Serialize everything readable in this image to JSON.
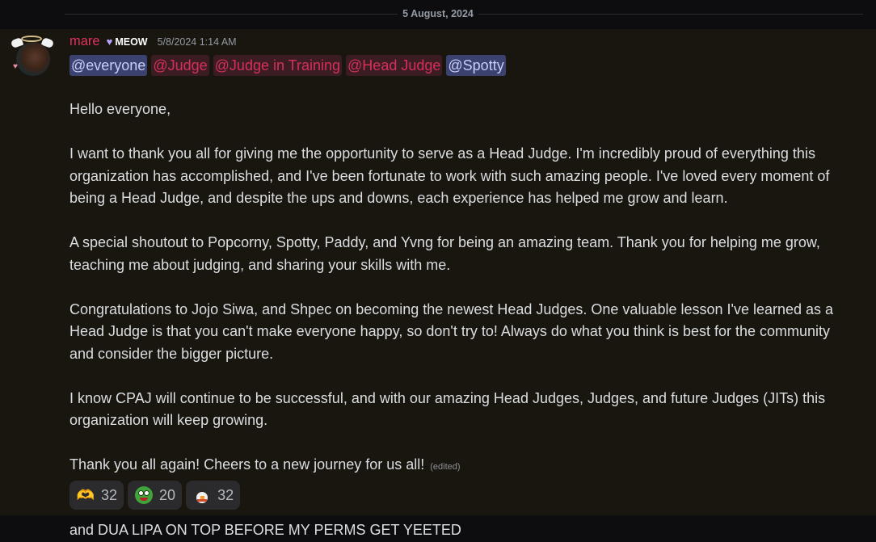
{
  "date_divider": "5 August, 2024",
  "message": {
    "author": {
      "username": "mare",
      "username_color": "#e0345e",
      "tag_icon": "heart-icon",
      "tag": "MEOW",
      "timestamp": "5/8/2024 1:14 AM"
    },
    "mentions": [
      {
        "text": "@everyone",
        "style": "blue"
      },
      {
        "text": "@Judge",
        "style": "red"
      },
      {
        "text": "@Judge in Training",
        "style": "red"
      },
      {
        "text": "@Head Judge",
        "style": "red"
      },
      {
        "text": "@Spotty",
        "style": "blue"
      }
    ],
    "paragraphs": [
      "Hello everyone,",
      "I want to thank you all for giving me the opportunity to serve as a Head Judge. I'm incredibly proud of everything this organization has accomplished, and I've been fortunate to work with such amazing people. I've loved every moment of being a Head Judge, and despite the ups and downs, each experience has helped me grow and learn.",
      "A special shoutout to Popcorny, Spotty, Paddy, and Yvng for being an amazing team. Thank you for helping me grow, teaching me about judging, and sharing your skills with me.",
      "Congratulations to Jojo Siwa, and Shpec on becoming the newest Head Judges. One valuable lesson I've learned as a Head Judge is that you can't make everyone happy, so don't try to! Always do what you think is best for the community and consider the bigger picture.",
      "I know CPAJ will continue to be successful, and with our amazing Head Judges, Judges, and future Judges (JITs) this organization will keep growing.",
      "Thank you all again! Cheers to a new journey for us all!"
    ],
    "edited_label": "(edited)",
    "reactions": [
      {
        "icon": "heart-hands-icon",
        "glyph": "🫶",
        "count": "32"
      },
      {
        "icon": "frog-face-icon",
        "count": "20"
      },
      {
        "icon": "chicken-icon",
        "count": "32"
      }
    ]
  },
  "next_message": {
    "text": "and DUA LIPA ON TOP BEFORE MY PERMS GET YEETED"
  },
  "colors": {
    "background": "#0d0d0f",
    "highlighted_message": "#19150f",
    "mention_blue_bg": "#3c4270",
    "mention_red_bg": "#3a1c22",
    "reaction_bg": "#2b2a2c"
  }
}
